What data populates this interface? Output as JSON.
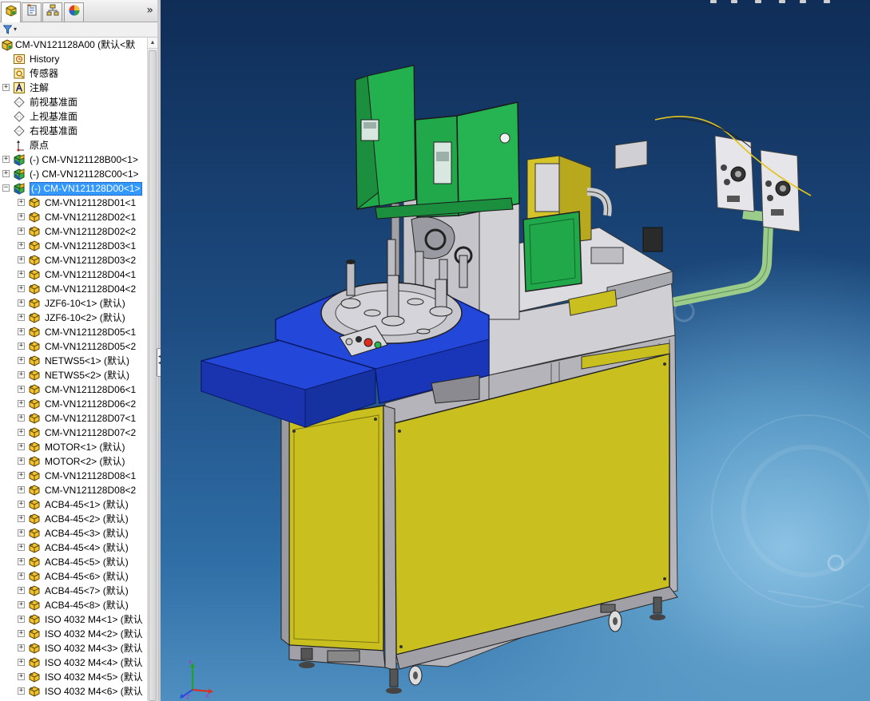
{
  "panel_tabs": [
    {
      "icon": "feature-manager-icon"
    },
    {
      "icon": "property-manager-icon"
    },
    {
      "icon": "configuration-manager-icon"
    },
    {
      "icon": "display-manager-icon"
    }
  ],
  "panel_expand_glyph": "»",
  "filter": {
    "icon": "filter-icon",
    "dropdown": "▾"
  },
  "tree": {
    "root": "CM-VN121128A00  (默认<默",
    "items": [
      {
        "label": "History",
        "icon": "history-icon"
      },
      {
        "label": "传感器",
        "icon": "sensor-icon"
      },
      {
        "label": "注解",
        "icon": "annotation-icon",
        "expandable": true
      },
      {
        "label": "前视基准面",
        "icon": "plane-icon"
      },
      {
        "label": "上视基准面",
        "icon": "plane-icon"
      },
      {
        "label": "右视基准面",
        "icon": "plane-icon"
      },
      {
        "label": "原点",
        "icon": "origin-icon"
      },
      {
        "label": "(-) CM-VN121128B00<1>",
        "icon": "subassembly-icon",
        "expandable": true
      },
      {
        "label": "(-) CM-VN121128C00<1>",
        "icon": "subassembly-icon",
        "expandable": true
      },
      {
        "label": "(-) CM-VN121128D00<1>",
        "icon": "subassembly-icon",
        "expandable": true,
        "expanded": true,
        "selected": true
      },
      {
        "label": "CM-VN121128D01<1",
        "icon": "part-icon",
        "indent": 1
      },
      {
        "label": "CM-VN121128D02<1",
        "icon": "part-icon",
        "indent": 1
      },
      {
        "label": "CM-VN121128D02<2",
        "icon": "part-icon",
        "indent": 1
      },
      {
        "label": "CM-VN121128D03<1",
        "icon": "part-icon",
        "indent": 1
      },
      {
        "label": "CM-VN121128D03<2",
        "icon": "part-icon",
        "indent": 1
      },
      {
        "label": "CM-VN121128D04<1",
        "icon": "part-icon",
        "indent": 1
      },
      {
        "label": "CM-VN121128D04<2",
        "icon": "part-icon",
        "indent": 1
      },
      {
        "label": "JZF6-10<1> (默认)",
        "icon": "part-icon",
        "indent": 1
      },
      {
        "label": "JZF6-10<2> (默认)",
        "icon": "part-icon",
        "indent": 1
      },
      {
        "label": "CM-VN121128D05<1",
        "icon": "part-icon",
        "indent": 1
      },
      {
        "label": "CM-VN121128D05<2",
        "icon": "part-icon",
        "indent": 1
      },
      {
        "label": "NETWS5<1> (默认)",
        "icon": "part-icon",
        "indent": 1
      },
      {
        "label": "NETWS5<2> (默认)",
        "icon": "part-icon",
        "indent": 1
      },
      {
        "label": "CM-VN121128D06<1",
        "icon": "part-icon",
        "indent": 1
      },
      {
        "label": "CM-VN121128D06<2",
        "icon": "part-icon",
        "indent": 1
      },
      {
        "label": "CM-VN121128D07<1",
        "icon": "part-icon",
        "indent": 1
      },
      {
        "label": "CM-VN121128D07<2",
        "icon": "part-icon",
        "indent": 1
      },
      {
        "label": "MOTOR<1> (默认)",
        "icon": "part-icon",
        "indent": 1
      },
      {
        "label": "MOTOR<2> (默认)",
        "icon": "part-icon",
        "indent": 1
      },
      {
        "label": "CM-VN121128D08<1",
        "icon": "part-icon",
        "indent": 1
      },
      {
        "label": "CM-VN121128D08<2",
        "icon": "part-icon",
        "indent": 1
      },
      {
        "label": "ACB4-45<1> (默认)",
        "icon": "part-icon",
        "indent": 1
      },
      {
        "label": "ACB4-45<2> (默认)",
        "icon": "part-icon",
        "indent": 1
      },
      {
        "label": "ACB4-45<3> (默认)",
        "icon": "part-icon",
        "indent": 1
      },
      {
        "label": "ACB4-45<4> (默认)",
        "icon": "part-icon",
        "indent": 1
      },
      {
        "label": "ACB4-45<5> (默认)",
        "icon": "part-icon",
        "indent": 1
      },
      {
        "label": "ACB4-45<6> (默认)",
        "icon": "part-icon",
        "indent": 1
      },
      {
        "label": "ACB4-45<7> (默认)",
        "icon": "part-icon",
        "indent": 1
      },
      {
        "label": "ACB4-45<8> (默认)",
        "icon": "part-icon",
        "indent": 1
      },
      {
        "label": "ISO 4032 M4<1> (默认",
        "icon": "part-icon",
        "indent": 1
      },
      {
        "label": "ISO 4032 M4<2> (默认",
        "icon": "part-icon",
        "indent": 1
      },
      {
        "label": "ISO 4032 M4<3> (默认",
        "icon": "part-icon",
        "indent": 1
      },
      {
        "label": "ISO 4032 M4<4> (默认",
        "icon": "part-icon",
        "indent": 1
      },
      {
        "label": "ISO 4032 M4<5> (默认",
        "icon": "part-icon",
        "indent": 1
      },
      {
        "label": "ISO 4032 M4<6> (默认",
        "icon": "part-icon",
        "indent": 1
      }
    ]
  },
  "triad": {
    "x": "X",
    "y": "Y",
    "z": "Z"
  },
  "colors": {
    "enclosure_green": "#21a84a",
    "turntable_blue": "#1f3fd0",
    "cabinet_yellow": "#c9c020",
    "frame_grey": "#b8b8be",
    "selection": "#3399ff"
  }
}
